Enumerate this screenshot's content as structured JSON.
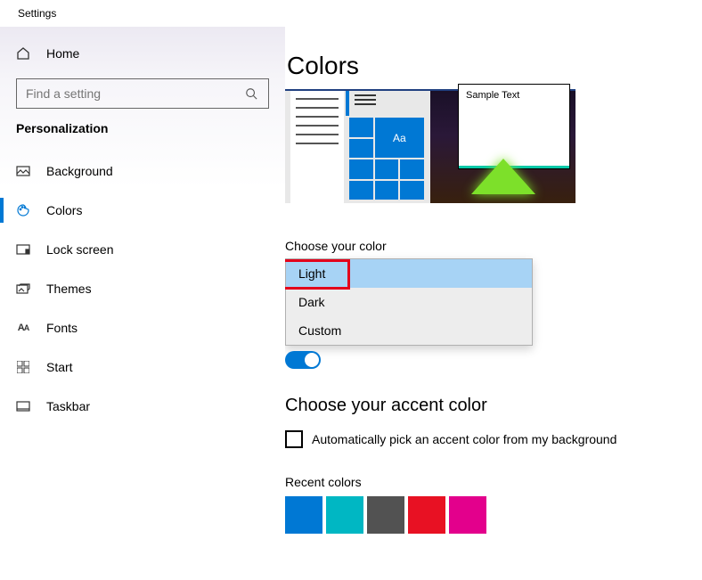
{
  "window": {
    "title": "Settings"
  },
  "sidebar": {
    "home_label": "Home",
    "search_placeholder": "Find a setting",
    "section_title": "Personalization",
    "items": [
      {
        "label": "Background"
      },
      {
        "label": "Colors"
      },
      {
        "label": "Lock screen"
      },
      {
        "label": "Themes"
      },
      {
        "label": "Fonts"
      },
      {
        "label": "Start"
      },
      {
        "label": "Taskbar"
      }
    ]
  },
  "main": {
    "title": "Colors",
    "preview_sample_text": "Sample Text",
    "preview_tile_label": "Aa",
    "choose_color_label": "Choose your color",
    "color_options": [
      {
        "label": "Light"
      },
      {
        "label": "Dark"
      },
      {
        "label": "Custom"
      }
    ],
    "accent_heading": "Choose your accent color",
    "auto_pick_label": "Automatically pick an accent color from my background",
    "recent_colors_label": "Recent colors",
    "recent_colors": [
      "#0078d4",
      "#00b7c3",
      "#525252",
      "#e81123",
      "#e3008c"
    ]
  }
}
